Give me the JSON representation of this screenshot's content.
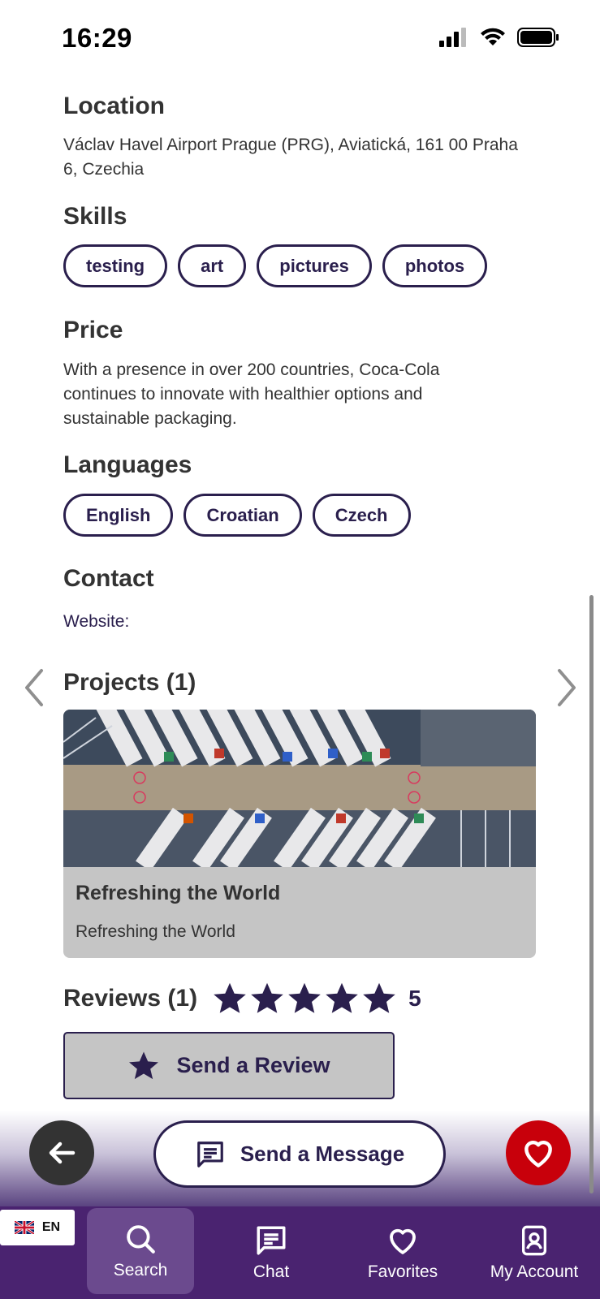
{
  "status_bar": {
    "time": "16:29"
  },
  "location": {
    "title": "Location",
    "text": "Václav Havel Airport Prague (PRG), Aviatická, 161 00 Praha 6, Czechia"
  },
  "skills": {
    "title": "Skills",
    "items": [
      "testing",
      "art",
      "pictures",
      "photos"
    ]
  },
  "price": {
    "title": "Price",
    "text": "With a presence in over 200 countries, Coca-Cola continues to innovate with healthier options and sustainable packaging."
  },
  "languages": {
    "title": "Languages",
    "items": [
      "English",
      "Croatian",
      "Czech"
    ]
  },
  "contact": {
    "title": "Contact",
    "website_label": "Website:"
  },
  "projects": {
    "title": "Projects (1)",
    "items": [
      {
        "title": "Refreshing the World",
        "subtitle": "Refreshing the World"
      }
    ]
  },
  "reviews": {
    "title": "Reviews (1)",
    "rating": "5",
    "stars": 5,
    "send_review_label": "Send a Review"
  },
  "actions": {
    "send_message_label": "Send a Message"
  },
  "language_badge": {
    "code": "EN"
  },
  "bottom_nav": {
    "items": [
      {
        "label": "Search",
        "icon": "search-icon",
        "active": true
      },
      {
        "label": "Chat",
        "icon": "chat-icon",
        "active": false
      },
      {
        "label": "Favorites",
        "icon": "heart-icon",
        "active": false
      },
      {
        "label": "My Account",
        "icon": "account-icon",
        "active": false
      }
    ]
  },
  "colors": {
    "primary": "#2a1f4d",
    "nav_bg": "#4a2370",
    "favorite": "#c8000b",
    "card_bg": "#c5c5c5"
  }
}
